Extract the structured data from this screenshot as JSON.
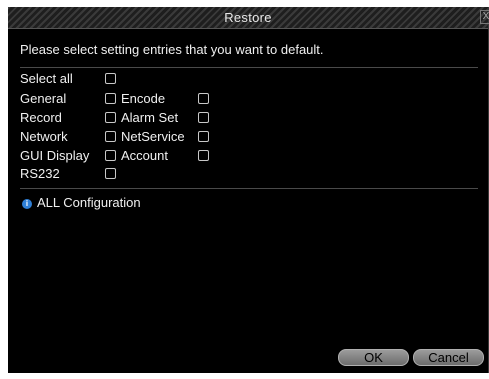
{
  "dialog": {
    "title": "Restore",
    "close_label": "X",
    "instruction": "Please select setting entries that you want to default."
  },
  "entries": {
    "select_all": "Select all",
    "general": "General",
    "encode": "Encode",
    "record": "Record",
    "alarm_set": "Alarm Set",
    "network": "Network",
    "netservice": "NetService",
    "gui_display": "GUI Display",
    "account": "Account",
    "rs232": "RS232"
  },
  "info": {
    "icon": "info-icon",
    "text": "ALL Configuration"
  },
  "buttons": {
    "ok": "OK",
    "cancel": "Cancel"
  },
  "colors": {
    "background": "#000000",
    "text": "#f0f0f0",
    "info_icon": "#2f7fd6",
    "button": "#8a8a8a"
  }
}
